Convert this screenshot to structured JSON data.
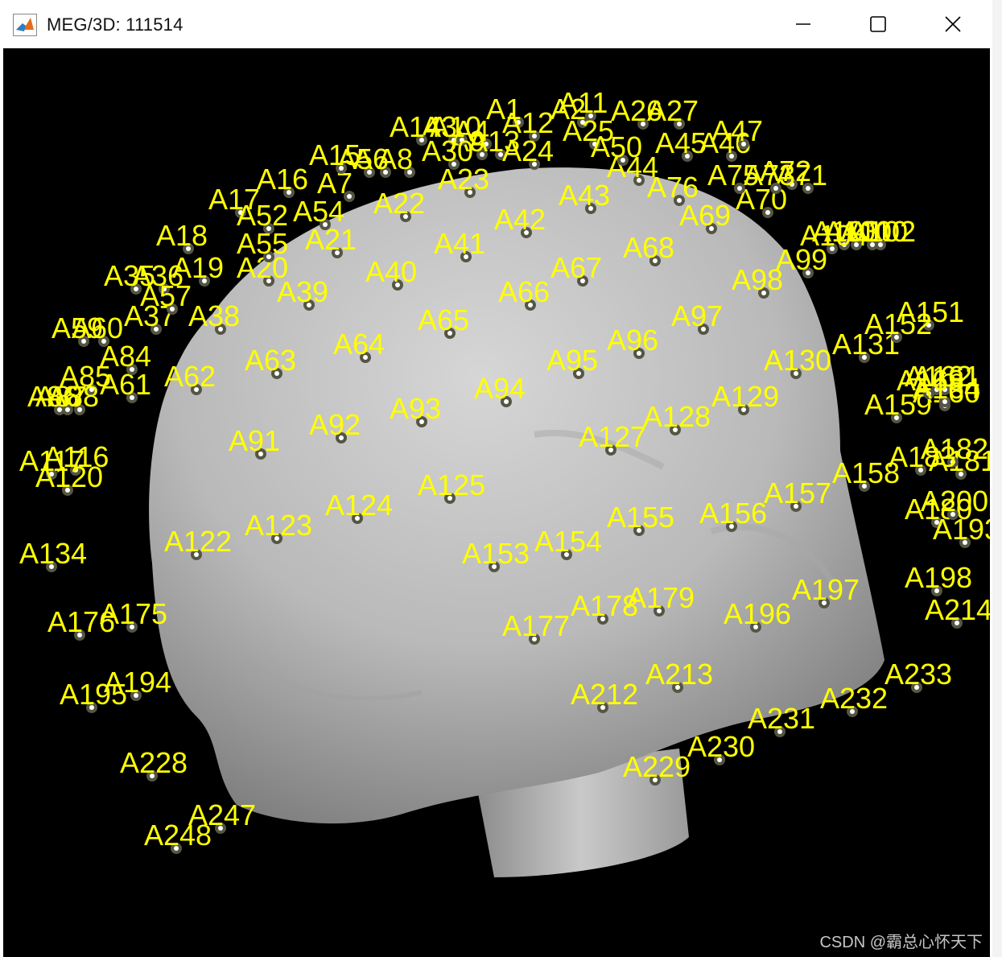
{
  "window": {
    "title": "MEG/3D: 111514"
  },
  "controls": {
    "minimize": "minimize-icon",
    "maximize": "maximize-icon",
    "close": "close-icon"
  },
  "colors": {
    "label": "#ffff00",
    "background": "#000000",
    "head": "#b8b8b8",
    "sensor": "#ffffff"
  },
  "watermark": "CSDN @霸总心怀天下",
  "sensors": [
    "A1",
    "A2",
    "A3",
    "A4",
    "A5",
    "A6",
    "A7",
    "A8",
    "A9",
    "A10",
    "A11",
    "A12",
    "A13",
    "A14",
    "A15",
    "A16",
    "A17",
    "A18",
    "A19",
    "A20",
    "A21",
    "A22",
    "A23",
    "A24",
    "A25",
    "A26",
    "A27",
    "A30",
    "A35",
    "A36",
    "A37",
    "A38",
    "A39",
    "A40",
    "A41",
    "A42",
    "A43",
    "A44",
    "A45",
    "A46",
    "A47",
    "A50",
    "A52",
    "A54",
    "A55",
    "A57",
    "A59",
    "A60",
    "A61",
    "A62",
    "A63",
    "A64",
    "A65",
    "A66",
    "A67",
    "A68",
    "A69",
    "A70",
    "A71",
    "A72",
    "A73",
    "A75",
    "A76",
    "A84",
    "A85",
    "A86",
    "A87",
    "A88",
    "A91",
    "A92",
    "A93",
    "A94",
    "A95",
    "A96",
    "A97",
    "A98",
    "A99",
    "A100",
    "A101",
    "A102",
    "A103",
    "A104",
    "A116",
    "A117",
    "A120",
    "A122",
    "A123",
    "A124",
    "A125",
    "A127",
    "A128",
    "A129",
    "A130",
    "A131",
    "A134",
    "A151",
    "A152",
    "A153",
    "A154",
    "A155",
    "A156",
    "A157",
    "A158",
    "A159",
    "A160",
    "A161",
    "A162",
    "A163",
    "A164",
    "A175",
    "A176",
    "A177",
    "A178",
    "A179",
    "A180",
    "A181",
    "A182",
    "A183",
    "A193",
    "A194",
    "A195",
    "A196",
    "A197",
    "A198",
    "A200",
    "A212",
    "A213",
    "A214",
    "A228",
    "A229",
    "A230",
    "A231",
    "A232",
    "A233",
    "A247",
    "A248"
  ]
}
